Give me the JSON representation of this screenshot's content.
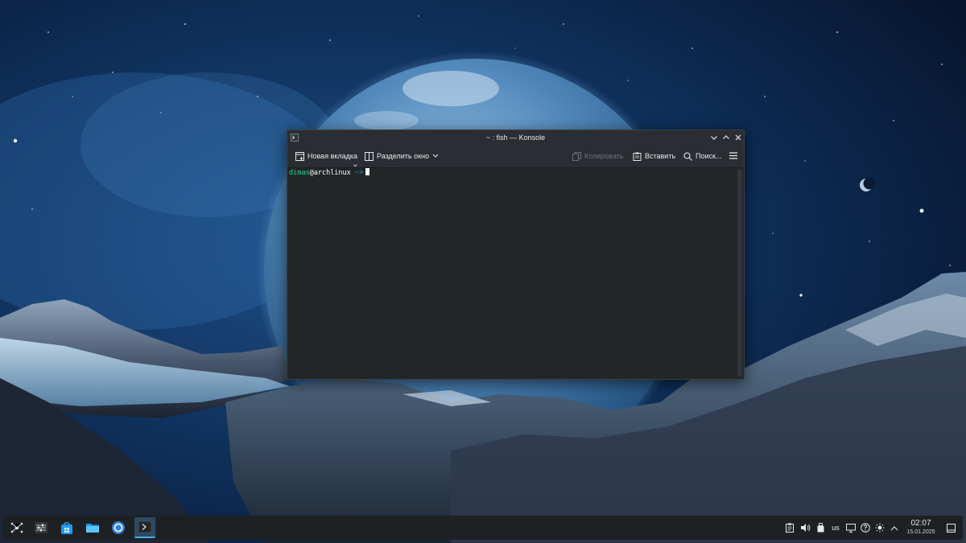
{
  "window": {
    "title": "~ : fish — Konsole",
    "toolbar": {
      "new_tab": "Новая вкладка",
      "split_view": "Разделить окно",
      "copy": "Копировать",
      "paste": "Вставить",
      "find": "Поиск..."
    },
    "terminal": {
      "user": "dimas",
      "at": "@",
      "host": "archlinux",
      "path": " ~>"
    }
  },
  "taskbar": {
    "keyboard_layout": "us",
    "time": "02:07",
    "date": "15.01.2025"
  },
  "colors": {
    "accent": "#3daee9",
    "prompt_user": "#1cdc9a",
    "prompt_path": "#1d99f3"
  }
}
